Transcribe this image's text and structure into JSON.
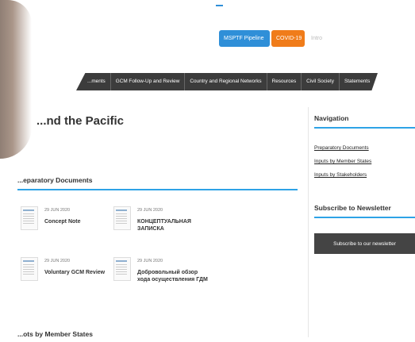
{
  "header": {
    "pills": [
      "MSPTF Pipeline",
      "COVID-19",
      "Intro"
    ]
  },
  "nav": {
    "items": [
      "...ments",
      "GCM Follow-Up and Review",
      "Country and Regional Networks",
      "Resources",
      "Civil Society",
      "Statements"
    ]
  },
  "main": {
    "title": "...nd the Pacific",
    "preparatory_title": "...eparatory Documents",
    "documents": [
      {
        "date": "29 JUN 2020",
        "name": "Concept Note"
      },
      {
        "date": "29 JUN 2020",
        "name": "КОНЦЕПТУАЛЬНАЯ ЗАПИСКА"
      },
      {
        "date": "29 JUN 2020",
        "name": "Voluntary GCM Review"
      },
      {
        "date": "29 JUN 2020",
        "name": "Добровольный обзор хода осуществления ГДМ"
      }
    ],
    "inputs_title": "...ots by Member States"
  },
  "sidebar": {
    "navigation_title": "Navigation",
    "links": [
      "Preparatory Documents",
      "Inputs by Member States",
      "Inputs by Stakeholders"
    ],
    "newsletter_title": "Subscribe to Newsletter",
    "subscribe_button": "Subscribe to our newsletter"
  },
  "colors": {
    "accent": "#2ea3e6",
    "nav_bg": "#3c3c3c",
    "pill_blue": "#2f8fd8",
    "pill_orange": "#f07c1a"
  }
}
